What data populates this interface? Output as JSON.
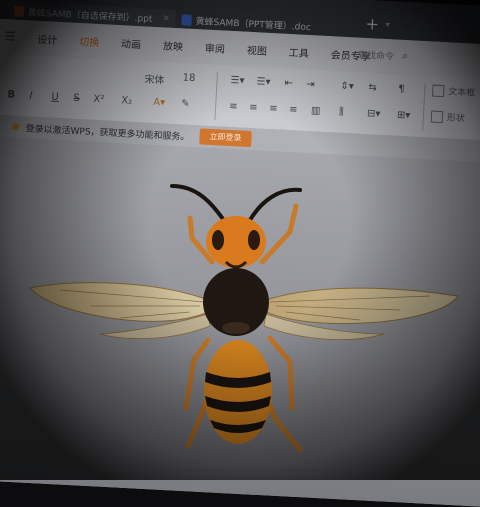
{
  "tabs": [
    {
      "label": "黄蜂SAMB（自选保存到）.ppt",
      "icon": "ppt-file-icon"
    },
    {
      "label": "黄蜂SAMB（PPT管理）.doc",
      "icon": "doc-file-icon"
    }
  ],
  "window": {
    "new_tab_label": "+",
    "tab_menu_label": "▾"
  },
  "menu": {
    "items": [
      "设计",
      "切换",
      "动画",
      "放映",
      "审阅",
      "视图",
      "工具",
      "会员专享"
    ],
    "active_index": 1,
    "search_text": "查找命令",
    "search_icon": "search-icon"
  },
  "toolbar": {
    "font_name": "宋体",
    "font_size": "18",
    "format_buttons": [
      "B",
      "I",
      "U",
      "S",
      "X²",
      "X₂"
    ],
    "right_labels": [
      "文本框",
      "形状"
    ]
  },
  "notification": {
    "text": "登录以激活WPS，获取更多功能和服务。",
    "button_label": "立即登录"
  },
  "slide": {
    "image_subject": "hornet-photo",
    "colors": {
      "body": "#d97a1e",
      "dark": "#1a1410",
      "wing": "#e7cf9a"
    }
  }
}
